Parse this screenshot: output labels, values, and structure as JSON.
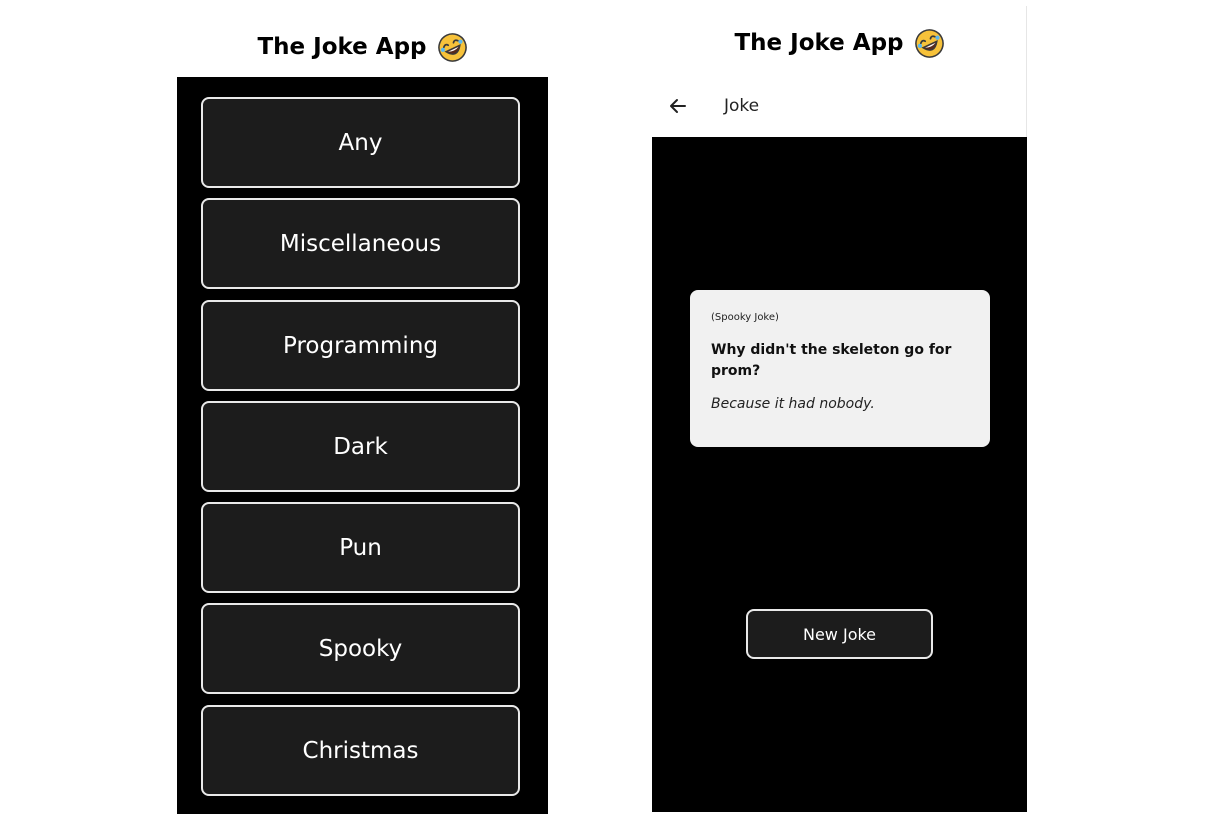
{
  "app": {
    "title": "The Joke App",
    "title_icon": "rolling-on-floor-laughing-emoji"
  },
  "categories_screen": {
    "items": [
      {
        "label": "Any"
      },
      {
        "label": "Miscellaneous"
      },
      {
        "label": "Programming"
      },
      {
        "label": "Dark"
      },
      {
        "label": "Pun"
      },
      {
        "label": "Spooky"
      },
      {
        "label": "Christmas"
      }
    ]
  },
  "joke_screen": {
    "appbar": {
      "back_icon": "arrow-left-icon",
      "title": "Joke"
    },
    "joke": {
      "category": "(Spooky Joke)",
      "setup": "Why didn't the skeleton go for prom?",
      "delivery": "Because it had nobody."
    },
    "new_joke_label": "New Joke"
  },
  "colors": {
    "panel_background": "#000000",
    "button_background": "#1c1c1c",
    "button_border": "#e9e9e9",
    "card_background": "#f1f1f1"
  }
}
